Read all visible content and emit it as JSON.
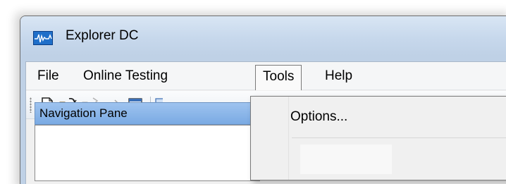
{
  "window": {
    "title": "Explorer DC",
    "icon": "waveform-app-icon"
  },
  "menubar": {
    "items": [
      {
        "label": "File"
      },
      {
        "label": "Online Testing"
      },
      {
        "label": "Tools",
        "open": true
      },
      {
        "label": "Help"
      }
    ]
  },
  "toolbar": {
    "buttons": [
      {
        "icon": "new-document-icon"
      },
      {
        "icon": "open-folder-icon"
      },
      {
        "icon": "save-folder-icon",
        "disabled": true
      },
      {
        "icon": "connect-icon",
        "disabled": true
      },
      {
        "icon": "report-icon"
      },
      {
        "icon": "partial-icon"
      }
    ]
  },
  "nav_pane": {
    "title": "Navigation Pane"
  },
  "tools_menu": {
    "items": [
      {
        "label": "Options..."
      }
    ]
  },
  "colors": {
    "titlebar": "#c7d8ec",
    "nav_header": "#8fb8eb",
    "menu_open_bg": "#fafafa"
  }
}
